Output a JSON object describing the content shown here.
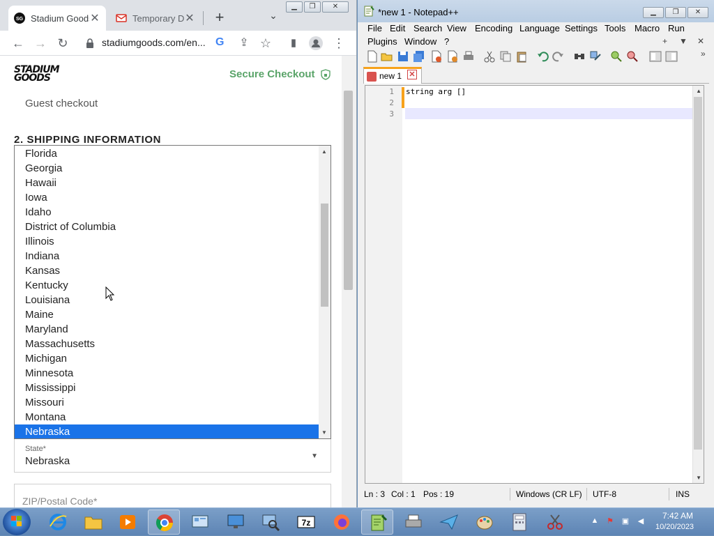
{
  "chrome": {
    "tabs": [
      {
        "title": "Stadium Goods",
        "active": true
      },
      {
        "title": "Temporary Di",
        "active": false
      }
    ],
    "url": "stadiumgoods.com/en...",
    "page": {
      "logo_text": "STADIUM GOODS",
      "secure_checkout": "Secure Checkout",
      "guest_checkout": "Guest checkout",
      "shipping_heading": "2. SHIPPING INFORMATION",
      "state_options": [
        "Florida",
        "Georgia",
        "Hawaii",
        "Iowa",
        "Idaho",
        "District of Columbia",
        "Illinois",
        "Indiana",
        "Kansas",
        "Kentucky",
        "Louisiana",
        "Maine",
        "Maryland",
        "Massachusetts",
        "Michigan",
        "Minnesota",
        "Mississippi",
        "Missouri",
        "Montana",
        "Nebraska"
      ],
      "selected_state": "Nebraska",
      "state_label": "State*",
      "state_value": "Nebraska",
      "zip_placeholder": "ZIP/Postal Code*"
    }
  },
  "notepad": {
    "title": "*new 1 - Notepad++",
    "menus": [
      "File",
      "Edit",
      "Search",
      "View",
      "Encoding",
      "Language",
      "Settings",
      "Tools",
      "Macro",
      "Run",
      "Plugins",
      "Window",
      "?"
    ],
    "tab_label": "new 1",
    "lines": [
      "string arg []",
      "",
      ""
    ],
    "line_numbers": [
      "1",
      "2",
      "3"
    ],
    "status": {
      "ln": "Ln : 3",
      "col": "Col : 1",
      "pos": "Pos : 19",
      "eol": "Windows (CR LF)",
      "encoding": "UTF-8",
      "mode": "INS"
    }
  },
  "taskbar": {
    "time": "7:42 AM",
    "date": "10/20/2023",
    "apps": [
      "start",
      "internet-explorer",
      "file-explorer",
      "media-player",
      "chrome",
      "control-panel",
      "remote-desktop",
      "magnifier",
      "7zip",
      "firefox",
      "notepad-plus-plus",
      "fax-scanner",
      "paper-plane",
      "paint",
      "calculator",
      "snipping-tool"
    ]
  },
  "colors": {
    "secure_green": "#5aa469",
    "selection_blue": "#1a73e8",
    "npp_accent": "#f7a21b"
  }
}
